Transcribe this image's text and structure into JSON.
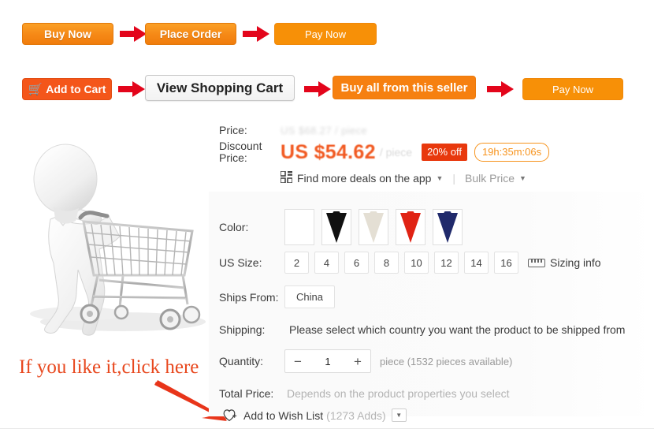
{
  "flow_row_1": [
    {
      "label": "Buy Now",
      "style": "orange-grad"
    },
    {
      "label": "Place Order",
      "style": "orange-grad"
    },
    {
      "label": "Pay Now",
      "style": "orange-flat"
    }
  ],
  "flow_row_2": [
    {
      "label": "Add to Cart",
      "style": "red-orange",
      "icon": "shopping-cart-icon"
    },
    {
      "label": "View Shopping Cart",
      "style": "grey-btn"
    },
    {
      "label": "Buy all from this seller",
      "style": "orange-deep"
    },
    {
      "label": "Pay Now",
      "style": "orange-flat"
    }
  ],
  "annotation": {
    "text": "If you like it,click here",
    "color": "#e8481e",
    "arrow": "red-arrow-icon"
  },
  "product_image": {
    "alt": "3d-white-figure-pushing-shopping-cart"
  },
  "price": {
    "label": "Price:",
    "original": "US $68.27 / piece",
    "discount_label_line1": "Discount",
    "discount_label_line2": "Price:",
    "discount_value": "US $54.62",
    "unit": "/ piece",
    "off_badge": "20% off",
    "off_badge_color": "#e8380d",
    "timer": "19h:35m:06s",
    "timer_color": "#f7941e",
    "app_deal": "Find more deals on the app",
    "bulk_price": "Bulk Price",
    "caret": "▼"
  },
  "properties": {
    "color": {
      "label": "Color:",
      "swatches": [
        {
          "name": "empty",
          "hex": "#ffffff"
        },
        {
          "name": "black",
          "hex": "#111111"
        },
        {
          "name": "white",
          "hex": "#e4dfd4"
        },
        {
          "name": "red",
          "hex": "#e02314"
        },
        {
          "name": "navy",
          "hex": "#202a6b"
        }
      ]
    },
    "us_size": {
      "label": "US Size:",
      "options": [
        "2",
        "4",
        "6",
        "8",
        "10",
        "12",
        "14",
        "16"
      ],
      "sizing_info": "Sizing info"
    },
    "ships_from": {
      "label": "Ships From:",
      "value": "China"
    },
    "shipping": {
      "label": "Shipping:",
      "note": "Please select which country you want the product to be shipped from"
    },
    "quantity": {
      "label": "Quantity:",
      "minus": "−",
      "value": "1",
      "plus": "+",
      "availability": "piece (1532 pieces available)"
    },
    "total_price": {
      "label": "Total Price:",
      "note": "Depends on the product properties you select"
    }
  },
  "wish_list": {
    "icon": "heart-plus-icon",
    "label": "Add to Wish List",
    "count": "(1273 Adds)",
    "caret": "▼"
  }
}
